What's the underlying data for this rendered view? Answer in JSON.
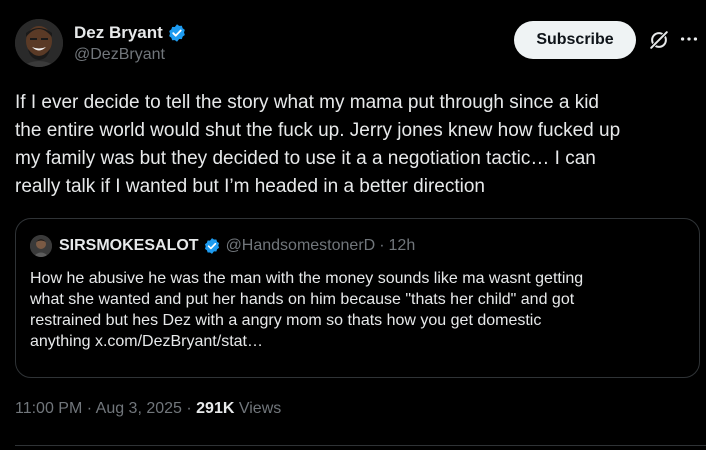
{
  "author": {
    "display_name": "Dez Bryant",
    "handle": "@DezBryant",
    "verified": true
  },
  "actions": {
    "subscribe_label": "Subscribe",
    "grok_icon": "grok-icon",
    "more_icon": "more-icon"
  },
  "tweet": {
    "text": "If I ever decide to tell the story what my mama put through since a kid\nthe entire world would shut the fuck up. Jerry jones knew how fucked up\nmy family was but they decided to use it a a negotiation tactic… I can\nreally talk if I wanted but I’m headed in a better direction"
  },
  "quote": {
    "display_name": "SIRSMOKESALOT",
    "handle": "@HandsomestonerD",
    "separator": "·",
    "time": "12h",
    "text": "How he abusive he was the man with the money sounds like ma wasnt getting\nwhat she wanted and put her hands on him because \"thats her child\" and got\nrestrained but hes Dez with a angry mom so thats how you get domestic\nanything x.com/DezBryant/stat…"
  },
  "meta": {
    "time": "11:00 PM",
    "sep1": " · ",
    "date": "Aug 3, 2025",
    "sep2": " · ",
    "views_count": "291K",
    "views_label": " Views"
  },
  "colors": {
    "background": "#000000",
    "text": "#e7e9ea",
    "secondary": "#71767b",
    "verified": "#1d9bf0",
    "border": "#2f3336"
  }
}
